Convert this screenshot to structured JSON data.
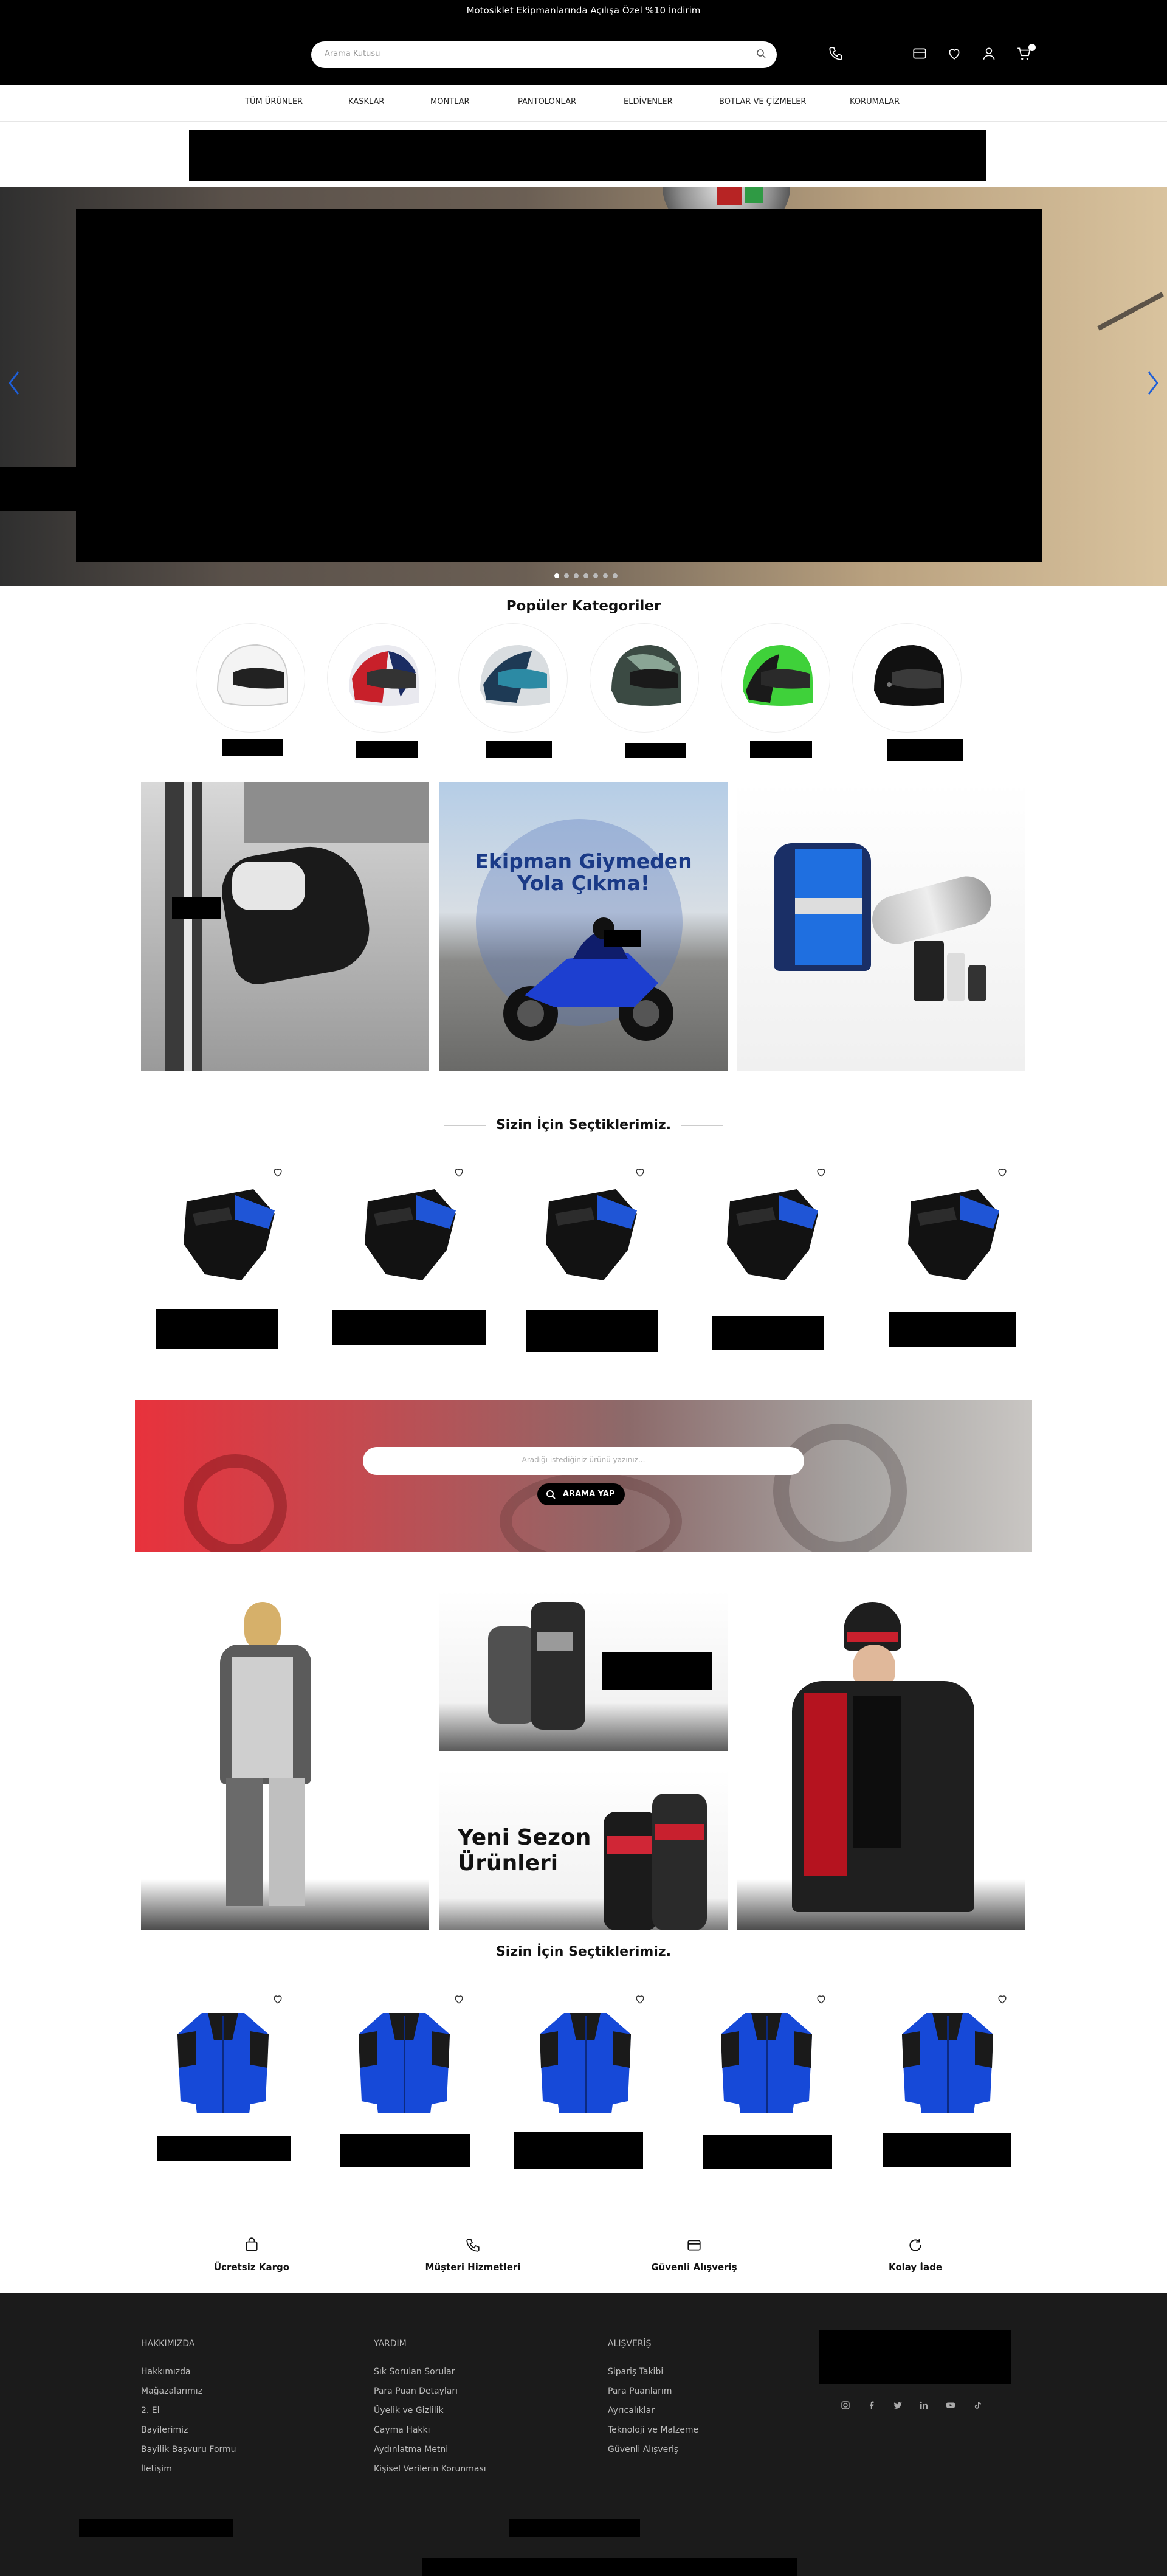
{
  "header": {
    "promo_text": "Motosiklet Ekipmanlarında Açılışa Özel %10 İndirim",
    "search_placeholder": "Arama Kutusu"
  },
  "nav": {
    "items": [
      "TÜM ÜRÜNLER",
      "KASKLAR",
      "MONTLAR",
      "PANTOLONLAR",
      "ELDİVENLER",
      "BOTLAR VE ÇİZMELER",
      "KORUMALAR"
    ]
  },
  "categories": {
    "title": "Popüler Kategoriler"
  },
  "promo_banner": {
    "line1": "Ekipman Giymeden",
    "line2": "Yola Çıkma!"
  },
  "section1": {
    "title": "Sizin İçin Seçtiklerimiz."
  },
  "search_banner": {
    "placeholder": "Aradığı istediğiniz ürünü yazınız...",
    "button_label": "ARAMA YAP"
  },
  "new_season": {
    "line1": "Yeni Sezon",
    "line2": "Ürünleri"
  },
  "section2": {
    "title": "Sizin İçin Seçtiklerimiz."
  },
  "features": [
    "Ücretsiz Kargo",
    "Müşteri Hizmetleri",
    "Güvenli Alışveriş",
    "Kolay İade"
  ],
  "footer": {
    "col1_title": "HAKKIMIZDA",
    "col1_links": [
      "Hakkımızda",
      "Mağazalarımız",
      "2. El",
      "Bayilerimiz",
      "Bayilik Başvuru Formu",
      "İletişim"
    ],
    "col2_title": "YARDIM",
    "col2_links": [
      "Sık Sorulan Sorular",
      "Para Puan Detayları",
      "Üyelik ve Gizlilik",
      "Cayma Hakkı",
      "Aydınlatma Metni",
      "Kişisel Verilerin Korunması"
    ],
    "col3_title": "ALIŞVERİŞ",
    "col3_links": [
      "Sipariş Takibi",
      "Para Puanlarım",
      "Ayrıcalıklar",
      "Teknoloji ve Malzeme",
      "Güvenli Alışveriş"
    ]
  },
  "colors": {
    "accent_blue": "#1e5fd8",
    "header_bg": "#000000",
    "footer_bg": "#1b1b1b",
    "banner_red": "#e8323c"
  }
}
